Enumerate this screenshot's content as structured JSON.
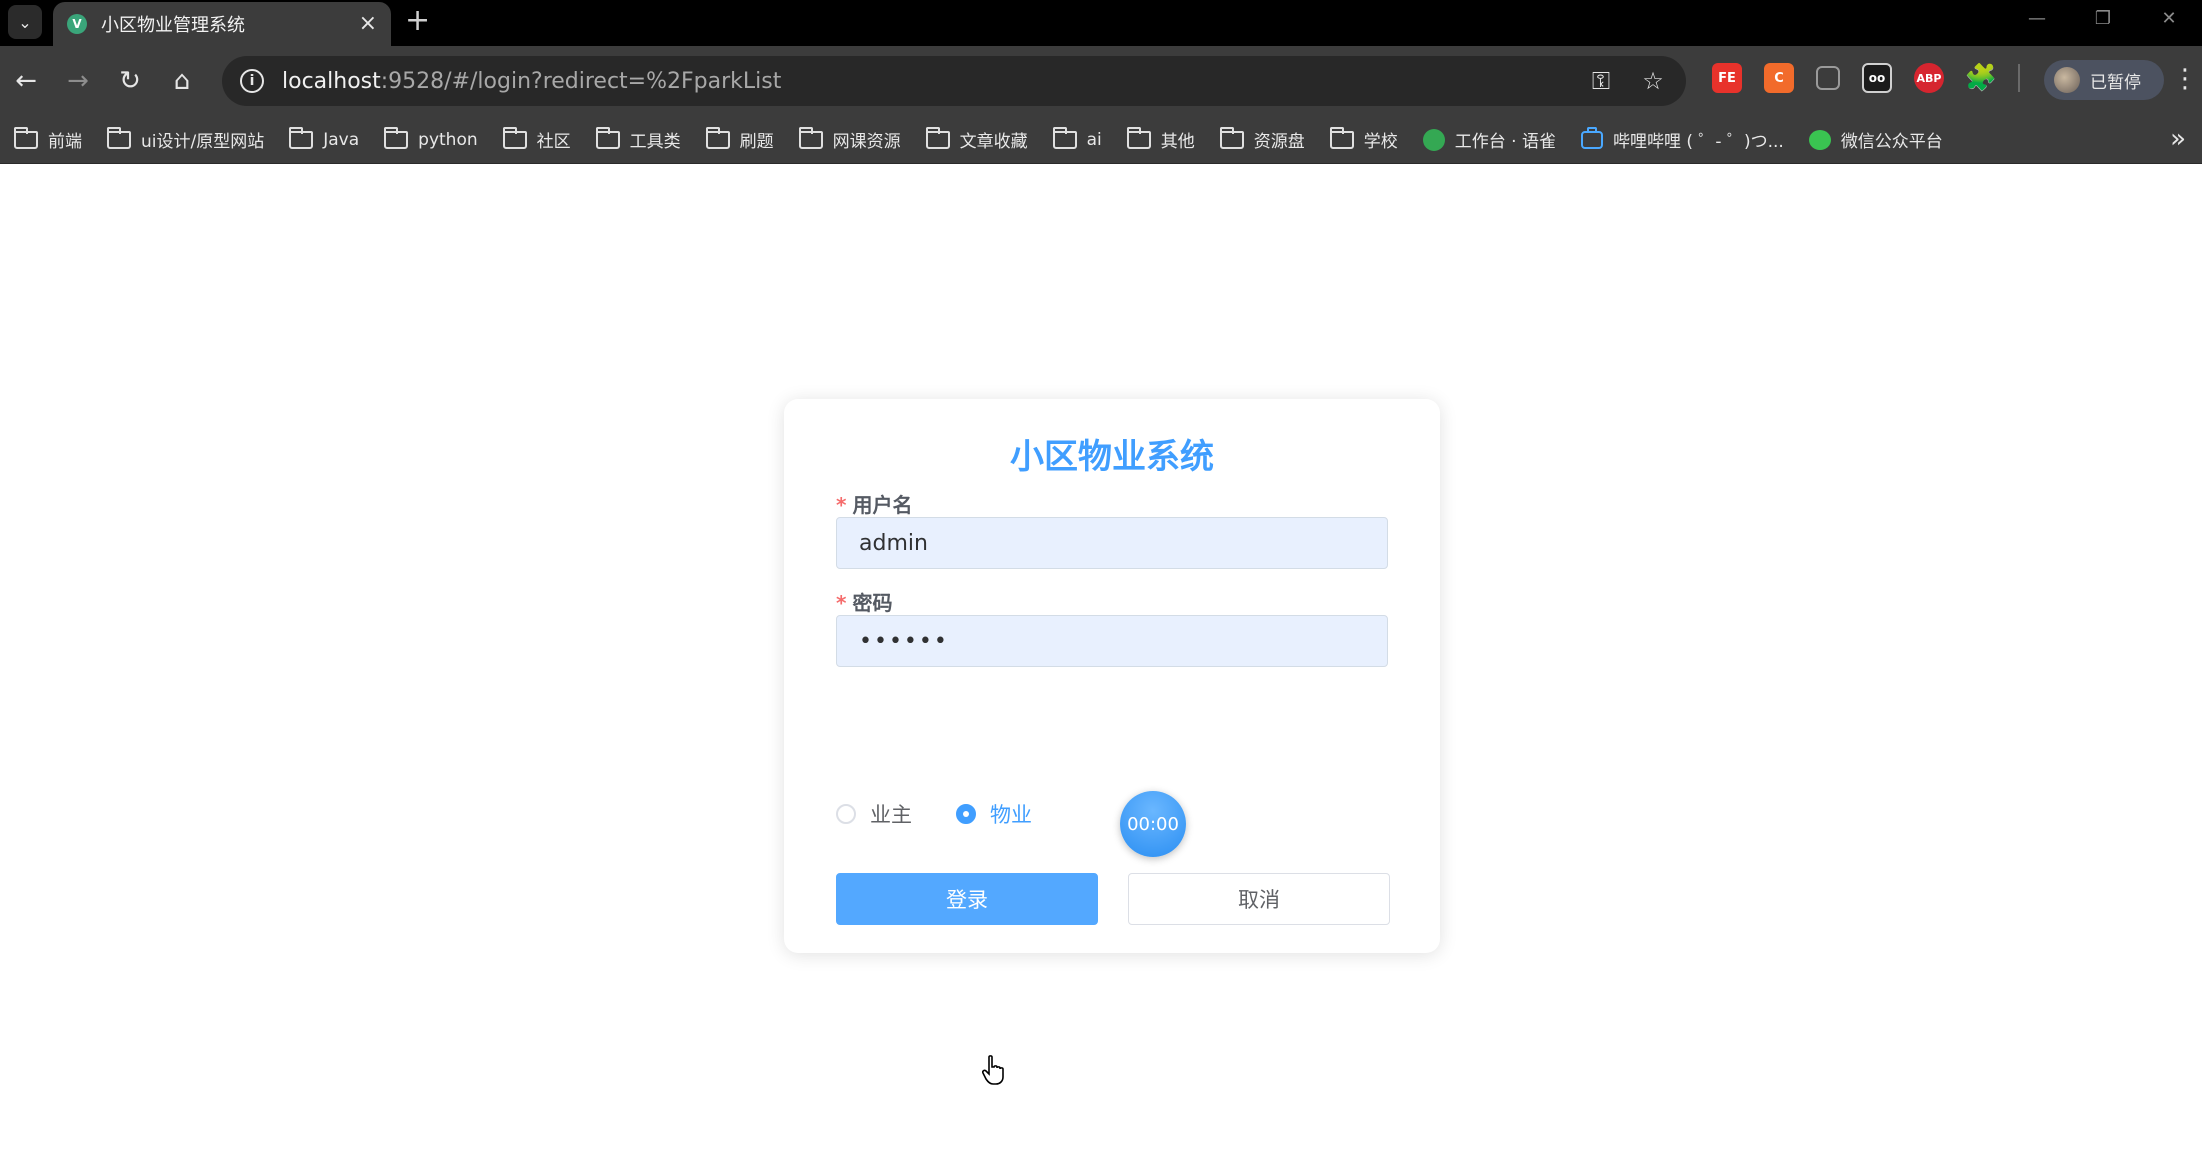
{
  "browser": {
    "tab_title": "小区物业管理系统",
    "tab_favicon": "V",
    "new_tab_label": "+",
    "url_host": "localhost",
    "url_rest": ":9528/#/login?redirect=%2FparkList",
    "profile_label": "已暂停",
    "extensions": [
      "FE",
      "C",
      "",
      "oo",
      "ABP",
      "🧩"
    ],
    "bookmarks": [
      {
        "label": "前端",
        "icon": "folder-icon"
      },
      {
        "label": "ui设计/原型网站",
        "icon": "folder-icon"
      },
      {
        "label": "Java",
        "icon": "folder-icon"
      },
      {
        "label": "python",
        "icon": "folder-icon"
      },
      {
        "label": "社区",
        "icon": "folder-icon"
      },
      {
        "label": "工具类",
        "icon": "folder-icon"
      },
      {
        "label": "刷题",
        "icon": "folder-icon"
      },
      {
        "label": "网课资源",
        "icon": "folder-icon"
      },
      {
        "label": "文章收藏",
        "icon": "folder-icon"
      },
      {
        "label": "ai",
        "icon": "folder-icon"
      },
      {
        "label": "其他",
        "icon": "folder-icon"
      },
      {
        "label": "资源盘",
        "icon": "folder-icon"
      },
      {
        "label": "学校",
        "icon": "folder-icon"
      },
      {
        "label": "工作台 · 语雀",
        "icon": "site-icon"
      },
      {
        "label": "哔哩哔哩 ( ゜- ゜)つ...",
        "icon": "bilibili-icon"
      },
      {
        "label": "微信公众平台",
        "icon": "wechat-icon"
      }
    ]
  },
  "login": {
    "title": "小区物业系统",
    "username_label": "用户名",
    "username_value": "admin",
    "password_label": "密码",
    "password_value": "••••••",
    "required_mark": "*",
    "radio_owner": "业主",
    "radio_property": "物业",
    "selected_role": "物业",
    "login_button": "登录",
    "cancel_button": "取消"
  },
  "timer": {
    "value": "00:00"
  },
  "colors": {
    "primary": "#409eff",
    "required": "#f56c6c",
    "input_bg": "#e8f0fe"
  }
}
